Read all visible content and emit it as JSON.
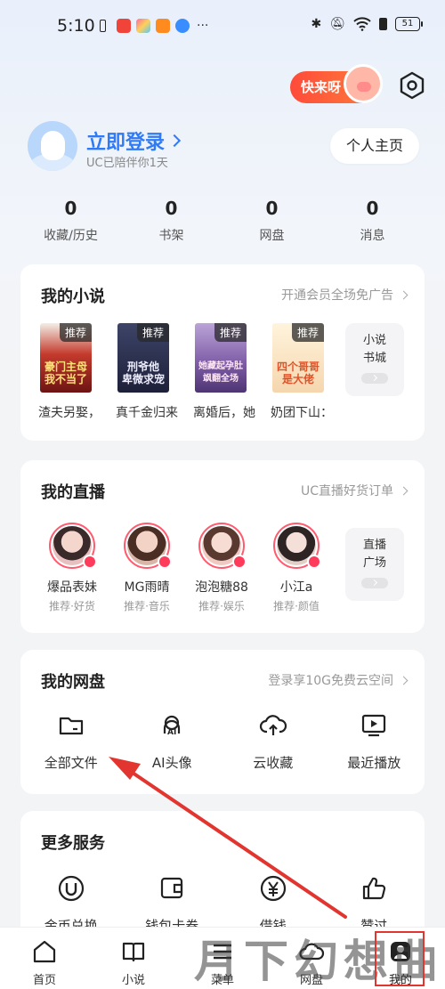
{
  "status_bar": {
    "time": "5:10",
    "left_dots": "···",
    "battery": "51",
    "icons": [
      "sim-alert-icon",
      "app-icon-red",
      "app-icon-colorful",
      "app-icon-orange",
      "app-icon-blue",
      "bluetooth-icon",
      "mute-icon",
      "wifi-icon",
      "sim-alert-icon",
      "battery-icon"
    ]
  },
  "header": {
    "promo_text": "快来呀",
    "settings_icon": "gear-icon"
  },
  "profile": {
    "login_text": "立即登录",
    "subtitle": "UC已陪伴你1天",
    "home_button": "个人主页"
  },
  "stats": [
    {
      "value": "0",
      "label": "收藏/历史"
    },
    {
      "value": "0",
      "label": "书架"
    },
    {
      "value": "0",
      "label": "网盘"
    },
    {
      "value": "0",
      "label": "消息"
    }
  ],
  "novels": {
    "title": "我的小说",
    "link": "开通会员全场免广告",
    "tag": "推荐",
    "books": [
      {
        "title": "渣夫另娶，",
        "cover_text": "豪门主母\n我不当了",
        "bg": "#8a1e1e",
        "fg": "#ffd866"
      },
      {
        "title": "真千金归来",
        "cover_text": "刑爷他\n卑微求宠",
        "bg": "#2a2f4d",
        "fg": "#e8e8ff"
      },
      {
        "title": "离婚后，她",
        "cover_text": "她藏起孕肚\n飒翻全场",
        "bg": "#7e5fa6",
        "fg": "#ffe3f3"
      },
      {
        "title": "奶团下山：",
        "cover_text": "四个哥哥\n是大佬",
        "bg": "#f4e2c8",
        "fg": "#e25b2a"
      }
    ],
    "side_tile": {
      "line1": "小说",
      "line2": "书城"
    }
  },
  "live": {
    "title": "我的直播",
    "link": "UC直播好货订单",
    "streamers": [
      {
        "name": "爆品表妹",
        "tags": "推荐·好货",
        "color": "#e9c0c0"
      },
      {
        "name": "MG雨晴",
        "tags": "推荐·音乐",
        "color": "#d9b6a8"
      },
      {
        "name": "泡泡糖88",
        "tags": "推荐·娱乐",
        "color": "#efc9c2"
      },
      {
        "name": "小江a",
        "tags": "推荐·颜值",
        "color": "#e2cfc8"
      }
    ],
    "side_tile": {
      "line1": "直播",
      "line2": "广场"
    }
  },
  "cloud": {
    "title": "我的网盘",
    "link": "登录享10G免费云空间",
    "items": [
      {
        "label": "全部文件",
        "icon": "folder-icon"
      },
      {
        "label": "AI头像",
        "icon": "ai-avatar-icon"
      },
      {
        "label": "云收藏",
        "icon": "cloud-upload-icon"
      },
      {
        "label": "最近播放",
        "icon": "video-play-icon"
      }
    ]
  },
  "services": {
    "title": "更多服务",
    "items": [
      {
        "label": "金币兑换",
        "icon": "coin-icon"
      },
      {
        "label": "钱包卡券",
        "icon": "wallet-icon"
      },
      {
        "label": "借钱",
        "icon": "yuan-icon"
      },
      {
        "label": "赞过",
        "icon": "thumbs-up-icon"
      }
    ]
  },
  "bottom_nav": [
    {
      "label": "首页",
      "icon": "home-icon"
    },
    {
      "label": "小说",
      "icon": "book-icon"
    },
    {
      "label": "菜单",
      "icon": "menu-icon"
    },
    {
      "label": "网盘",
      "icon": "cloud-icon"
    },
    {
      "label": "我的",
      "icon": "profile-icon"
    }
  ],
  "watermark": "月下幻想曲",
  "colors": {
    "accent": "#2f7af6",
    "annotation": "#e3352f",
    "promo": "#ff4b3a"
  }
}
